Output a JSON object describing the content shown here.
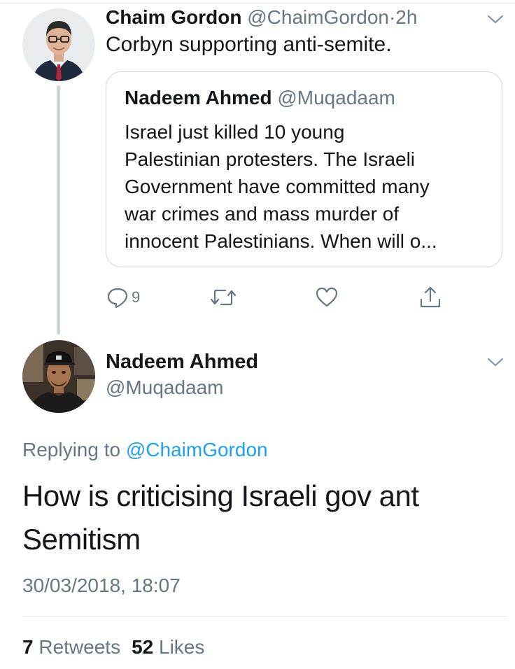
{
  "parent_tweet": {
    "author_name": "Chaim Gordon",
    "author_handle": "@ChaimGordon",
    "separator": "·",
    "time": "2h",
    "text": "Corbyn supporting anti-semite.",
    "quoted_tweet": {
      "author_name": "Nadeem Ahmed",
      "author_handle": "@Muqadaam",
      "text_lines": [
        "Israel just killed 10 young",
        "Palestinian protesters. The Israeli",
        "Government have committed many",
        "war crimes and mass murder of",
        "innocent Palestinians. When will o..."
      ]
    },
    "actions": {
      "reply_icon": "reply-icon",
      "reply_count": "9",
      "retweet_icon": "retweet-icon",
      "like_icon": "heart-icon",
      "share_icon": "share-icon"
    }
  },
  "focused_tweet": {
    "author_name": "Nadeem Ahmed",
    "author_handle": "@Muqadaam",
    "replying_prefix": "Replying to",
    "replying_mention": "@ChaimGordon",
    "text_lines": [
      "How is criticising Israeli gov ant",
      "Semitism"
    ],
    "timestamp": "30/03/2018, 18:07",
    "retweets_count": "7",
    "retweets_label": "Retweets",
    "likes_count": "52",
    "likes_label": "Likes"
  },
  "colors": {
    "text_primary": "#14171a",
    "text_secondary": "#657786",
    "accent": "#1da1f2",
    "border": "#ccd6dd"
  }
}
